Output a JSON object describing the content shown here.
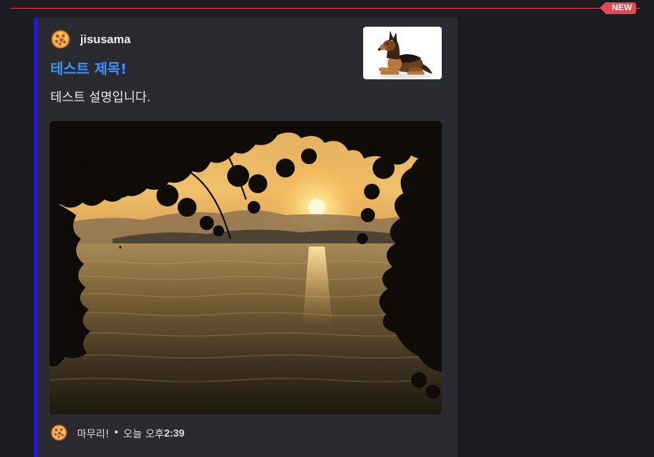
{
  "divider": {
    "badge_label": "NEW"
  },
  "embed": {
    "accent_color": "#1a14ff",
    "author": {
      "name": "jisusama",
      "icon": "pizza-icon"
    },
    "title": "테스트 제목!",
    "description": "테스트 설명입니다.",
    "thumbnail": {
      "icon": "german-shepherd-dog-image"
    },
    "image": {
      "icon": "sunset-lake-trees-image"
    },
    "footer": {
      "icon": "pizza-icon",
      "text": "마무리!",
      "separator": "•",
      "timestamp_day": "오늘 오후 ",
      "timestamp_time": "2:39"
    }
  },
  "colors": {
    "background": "#1c1c22",
    "embed_background": "#2a2a31",
    "title": "#3c90ff",
    "new_badge": "#e14a50"
  }
}
